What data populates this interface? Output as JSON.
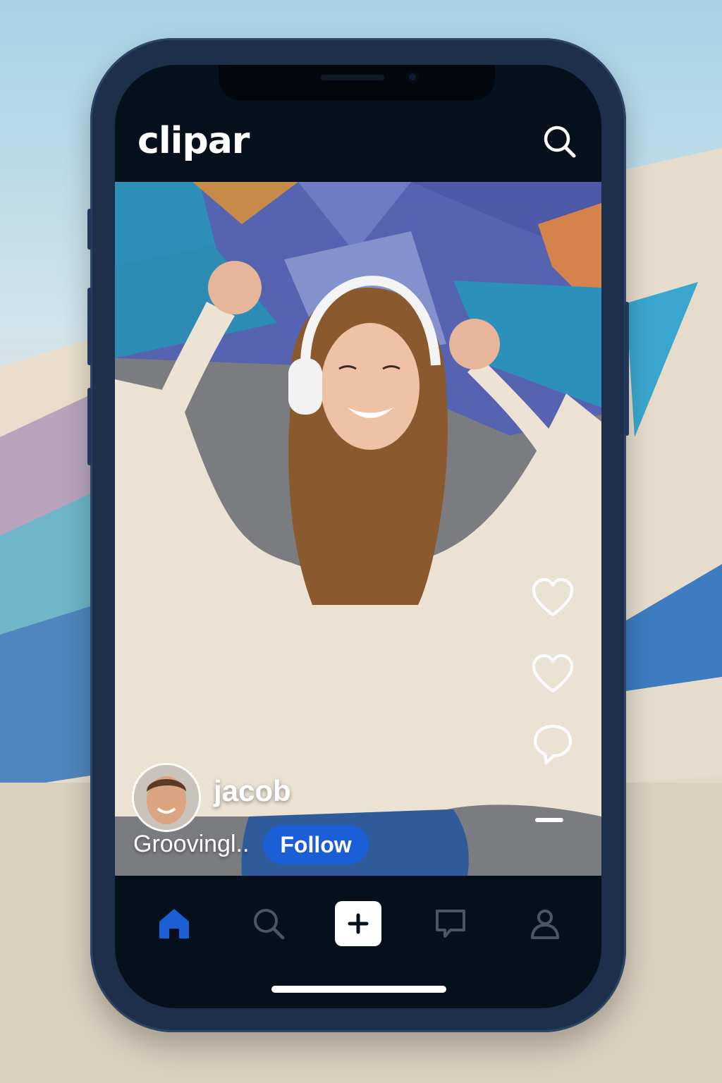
{
  "app": {
    "title": "clipar"
  },
  "post": {
    "username": "jacob",
    "caption": "Groovingl..",
    "follow_label": "Follow"
  },
  "side_actions": [
    "heart-icon",
    "heart-icon",
    "comment-icon",
    "more-dash"
  ],
  "nav": {
    "items": [
      "home-icon",
      "search-icon",
      "plus-icon",
      "chat-icon",
      "profile-icon"
    ],
    "active": "home-icon"
  },
  "colors": {
    "accent": "#1a5fd6",
    "screen_bg": "#06101d",
    "inactive_icon": "#4a5566"
  }
}
